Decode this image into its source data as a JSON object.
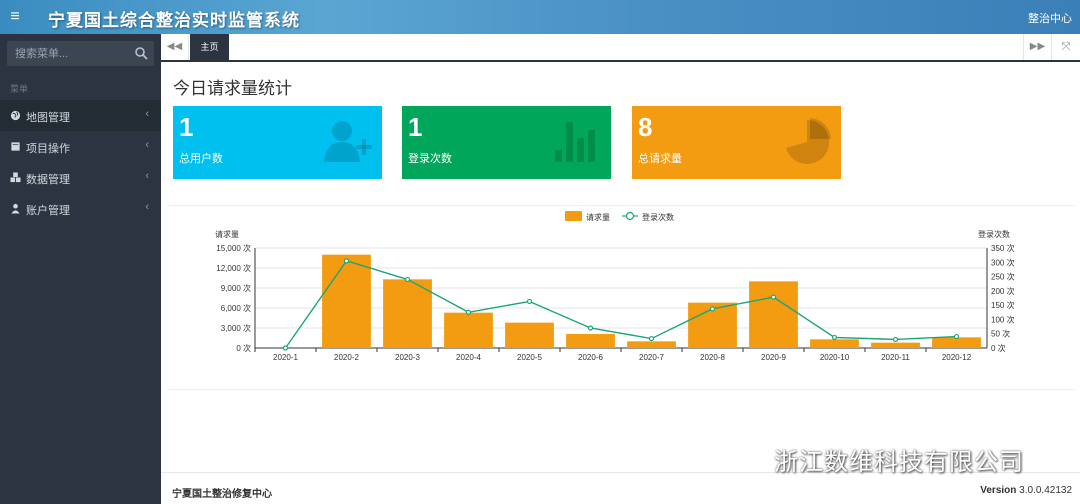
{
  "header": {
    "title": "宁夏国土综合整治实时监管系统",
    "right_link": "整治中心",
    "menu_toggle": "≡"
  },
  "sidebar": {
    "search_placeholder": "搜索菜单...",
    "menu_header": "菜单",
    "items": [
      {
        "label": "地图管理",
        "icon": "globe-icon"
      },
      {
        "label": "项目操作",
        "icon": "book-icon"
      },
      {
        "label": "数据管理",
        "icon": "cubes-icon"
      },
      {
        "label": "账户管理",
        "icon": "user-icon"
      }
    ]
  },
  "tabs": {
    "nav_left": "◀◀",
    "active": "主页",
    "nav_right": "▶▶",
    "fullscreen": "⤧"
  },
  "main": {
    "title": "今日请求量统计",
    "cards": [
      {
        "value": "1",
        "label": "总用户数",
        "color": "#00c0ef",
        "icon": "user-add-icon"
      },
      {
        "value": "1",
        "label": "登录次数",
        "color": "#00a65a",
        "icon": "bar-chart-icon"
      },
      {
        "value": "8",
        "label": "总请求量",
        "color": "#f39c12",
        "icon": "pie-chart-icon"
      }
    ]
  },
  "chart_data": {
    "type": "bar",
    "categories": [
      "2020-1",
      "2020-2",
      "2020-3",
      "2020-4",
      "2020-5",
      "2020-6",
      "2020-7",
      "2020-8",
      "2020-9",
      "2020-10",
      "2020-11",
      "2020-12"
    ],
    "series": [
      {
        "name": "请求量",
        "type": "bar",
        "axis": "left",
        "color": "#f39c12",
        "values": [
          0,
          14000,
          10300,
          5300,
          3800,
          2100,
          1000,
          6800,
          10000,
          1300,
          800,
          1600
        ]
      },
      {
        "name": "登录次数",
        "type": "line",
        "axis": "right",
        "color": "#1aa67a",
        "values": [
          0,
          305,
          240,
          125,
          163,
          70,
          33,
          137,
          178,
          37,
          30,
          40
        ]
      }
    ],
    "ylabel": "请求量",
    "ylabel_right": "登录次数",
    "ylim": [
      0,
      15000
    ],
    "ylim_right": [
      0,
      350
    ],
    "yticks": [
      "0 次",
      "3,000 次",
      "6,000 次",
      "9,000 次",
      "12,000 次",
      "15,000 次"
    ],
    "yticks_right": [
      "0 次",
      "50 次",
      "100 次",
      "150 次",
      "200 次",
      "250 次",
      "300 次",
      "350 次"
    ],
    "legend": "top-center",
    "grid": true
  },
  "footer": {
    "left": "宁夏国土整治修复中心",
    "version_label": "Version",
    "version": "3.0.0.42132"
  },
  "watermark": {
    "text": "浙江数维科技有限公司"
  }
}
